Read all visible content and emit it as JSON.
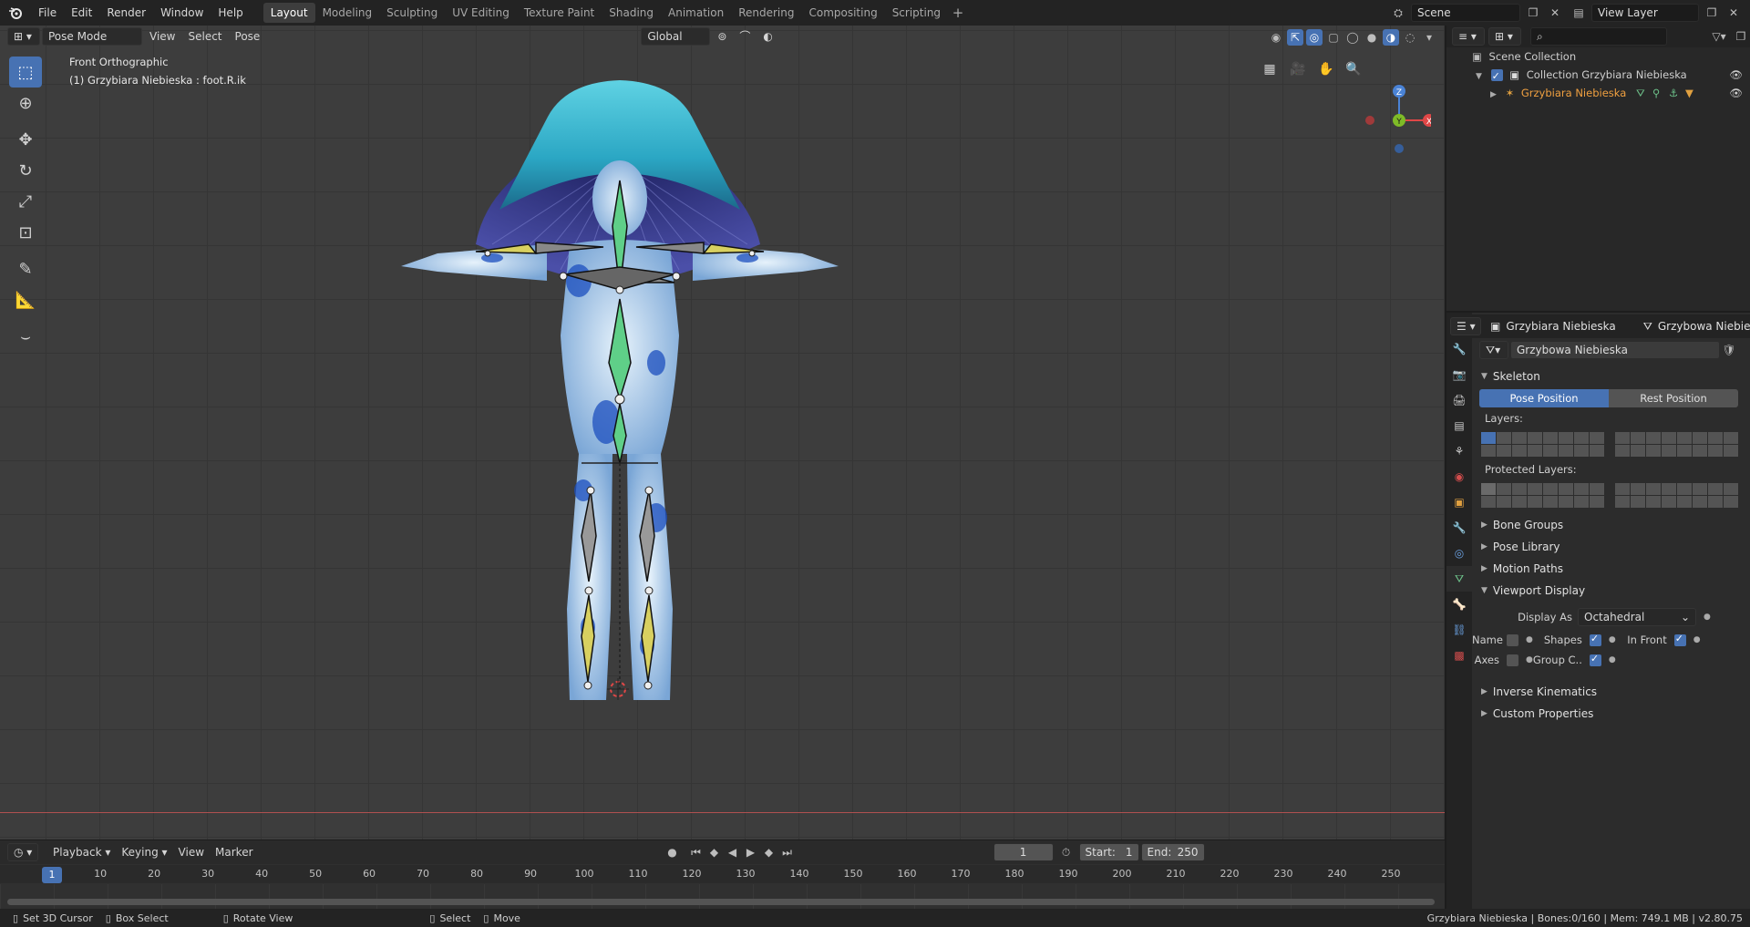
{
  "topbar": {
    "menus": [
      "File",
      "Edit",
      "Render",
      "Window",
      "Help"
    ],
    "workspaces": [
      "Layout",
      "Modeling",
      "Sculpting",
      "UV Editing",
      "Texture Paint",
      "Shading",
      "Animation",
      "Rendering",
      "Compositing",
      "Scripting"
    ],
    "active_workspace": "Layout",
    "add_icon": "+",
    "scene": "Scene",
    "view_layer": "View Layer"
  },
  "viewport": {
    "mode": "Pose Mode",
    "menus": [
      "View",
      "Select",
      "Pose"
    ],
    "transform_orientation": "Global",
    "view_name": "Front Orthographic",
    "active_object": "(1) Grzybiara Niebieska : foot.R.ik",
    "gizmo": {
      "z": "Z",
      "y": "Y",
      "x": "X"
    },
    "colors": {
      "grid_bg": "#3d3d3d",
      "accent": "#4772b3",
      "x_axis": "#e04747",
      "y_axis": "#7fbb27",
      "z_axis": "#4a83d6"
    }
  },
  "tools": [
    "select-box-icon",
    "cursor-icon",
    "move-icon",
    "rotate-icon",
    "scale-icon",
    "transform-icon",
    "annotate-icon",
    "measure-icon",
    "bone-tool-icon"
  ],
  "outliner": {
    "search_placeholder": "",
    "rows": [
      {
        "label": "Scene Collection"
      },
      {
        "label": "Collection Grzybiara Niebieska"
      },
      {
        "label": "Grzybiara Niebieska"
      }
    ]
  },
  "properties": {
    "object_name": "Grzybiara Niebieska",
    "armature_tab": "Grzybowa Niebieska",
    "data_name": "Grzybowa Niebieska",
    "skeleton": {
      "title": "Skeleton",
      "pose_position": "Pose Position",
      "rest_position": "Rest Position",
      "layers_label": "Layers:",
      "protected_label": "Protected Layers:"
    },
    "panels_collapsed_1": [
      "Bone Groups",
      "Pose Library",
      "Motion Paths"
    ],
    "viewport_display": {
      "title": "Viewport Display",
      "display_as_label": "Display As",
      "display_as_value": "Octahedral",
      "name_label": "Name",
      "shapes_label": "Shapes",
      "in_front_label": "In Front",
      "axes_label": "Axes",
      "group_colors_label": "Group C..",
      "name": false,
      "shapes": true,
      "in_front": true,
      "axes": false,
      "group_colors": true
    },
    "panels_collapsed_2": [
      "Inverse Kinematics",
      "Custom Properties"
    ]
  },
  "timeline": {
    "menus": [
      "Playback",
      "Keying",
      "View",
      "Marker"
    ],
    "current_frame": "1",
    "start_label": "Start:",
    "start": "1",
    "end_label": "End:",
    "end": "250",
    "ticks": [
      "1",
      "10",
      "20",
      "30",
      "40",
      "50",
      "60",
      "70",
      "80",
      "90",
      "100",
      "110",
      "120",
      "130",
      "140",
      "150",
      "160",
      "170",
      "180",
      "190",
      "200",
      "210",
      "220",
      "230",
      "240",
      "250"
    ]
  },
  "statusbar": {
    "items": [
      "Set 3D Cursor",
      "Box Select",
      "Rotate View",
      "Select",
      "Move"
    ],
    "info": "Grzybiara Niebieska | Bones:0/160 | Mem: 749.1 MB | v2.80.75"
  }
}
